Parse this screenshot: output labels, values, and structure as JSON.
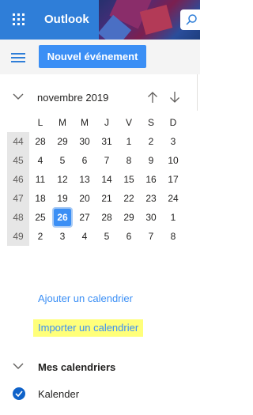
{
  "header": {
    "app_name": "Outlook",
    "waffle_icon": "app-launcher-icon",
    "search_icon": "search-icon",
    "accent": "#2f7ed8"
  },
  "toolbar": {
    "menu_icon": "hamburger-icon",
    "new_event_label": "Nouvel événement",
    "button_color": "#3b8ff5"
  },
  "calendar": {
    "month_label": "novembre 2019",
    "weekdays": [
      "L",
      "M",
      "M",
      "J",
      "V",
      "S",
      "D"
    ],
    "weeks": [
      {
        "num": "44",
        "days": [
          "28",
          "29",
          "30",
          "31",
          "1",
          "2",
          "3"
        ]
      },
      {
        "num": "45",
        "days": [
          "4",
          "5",
          "6",
          "7",
          "8",
          "9",
          "10"
        ]
      },
      {
        "num": "46",
        "days": [
          "11",
          "12",
          "13",
          "14",
          "15",
          "16",
          "17"
        ]
      },
      {
        "num": "47",
        "days": [
          "18",
          "19",
          "20",
          "21",
          "22",
          "23",
          "24"
        ]
      },
      {
        "num": "48",
        "days": [
          "25",
          "26",
          "27",
          "28",
          "29",
          "30",
          "1"
        ]
      },
      {
        "num": "49",
        "days": [
          "2",
          "3",
          "4",
          "5",
          "6",
          "7",
          "8"
        ]
      }
    ],
    "today": "26"
  },
  "links": {
    "add_calendar": "Ajouter un calendrier",
    "import_calendar": "Importer un calendrier",
    "highlight_color": "#ffff7a"
  },
  "my_calendars": {
    "title": "Mes calendriers",
    "items": [
      {
        "name": "Kalender",
        "checked": true
      }
    ]
  }
}
